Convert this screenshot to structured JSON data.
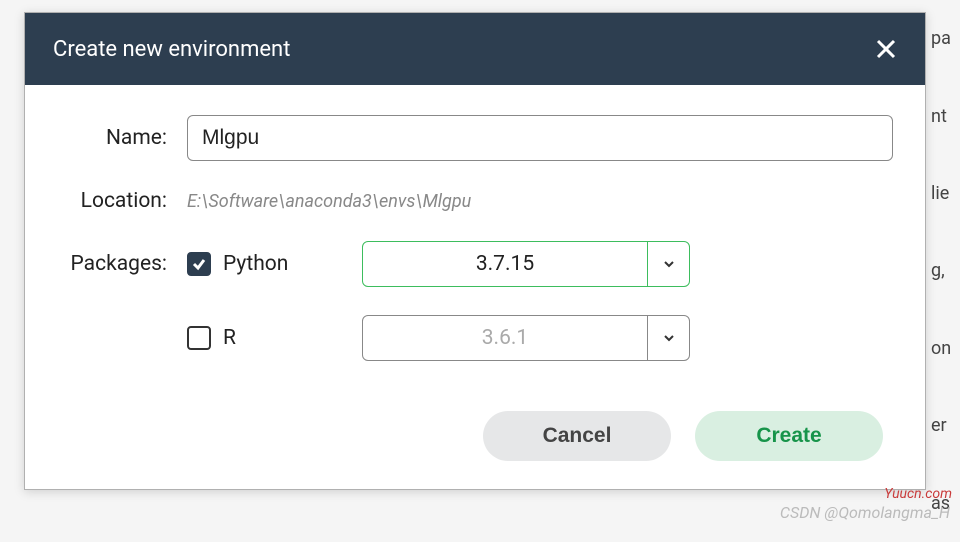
{
  "dialog": {
    "title": "Create new environment"
  },
  "form": {
    "name_label": "Name:",
    "name_value": "Mlgpu",
    "location_label": "Location:",
    "location_value": "E:\\Software\\anaconda3\\envs\\Mlgpu",
    "packages_label": "Packages:"
  },
  "packages": {
    "python": {
      "label": "Python",
      "checked": true,
      "version": "3.7.15"
    },
    "r": {
      "label": "R",
      "checked": false,
      "version": "3.6.1"
    }
  },
  "buttons": {
    "cancel": "Cancel",
    "create": "Create"
  },
  "background_fragments": [
    "pa",
    "nt",
    "lie",
    "g,",
    "on",
    "er",
    "as"
  ],
  "watermarks": {
    "site": "Yuucn.com",
    "author": "CSDN @Qomolangma_H"
  }
}
